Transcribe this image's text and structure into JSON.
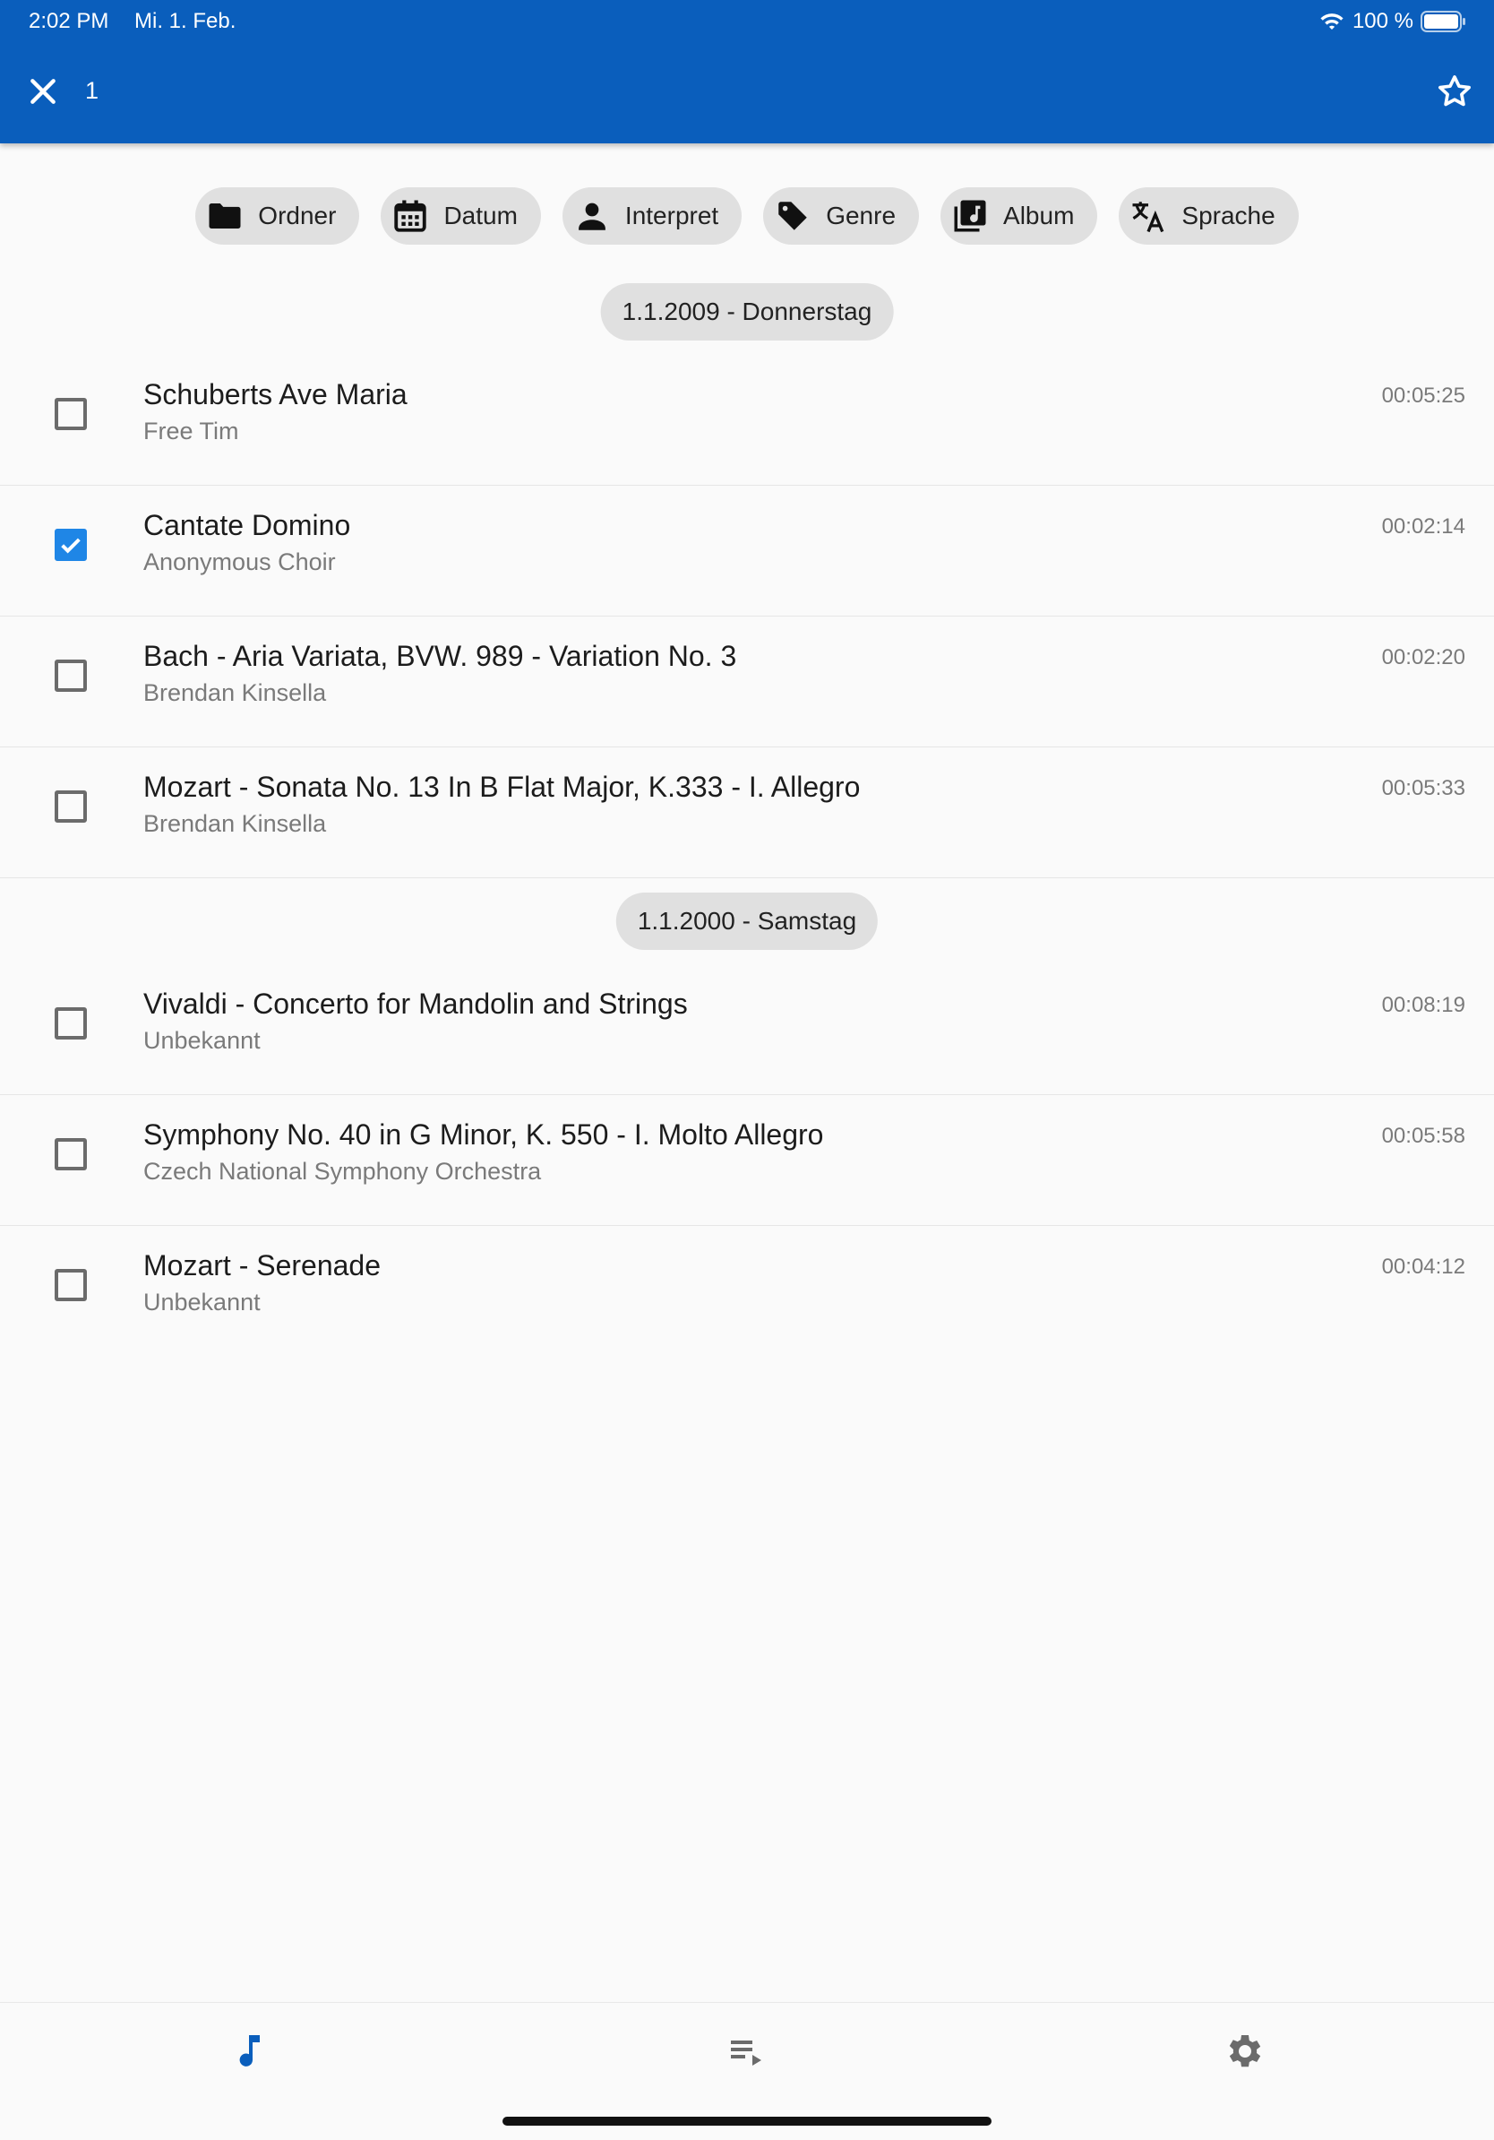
{
  "status_bar": {
    "time": "2:02 PM",
    "date": "Mi. 1. Feb.",
    "battery": "100 %"
  },
  "appbar": {
    "selected_count": "1"
  },
  "filters": [
    {
      "label": "Ordner",
      "icon": "folder-icon"
    },
    {
      "label": "Datum",
      "icon": "calendar-icon"
    },
    {
      "label": "Interpret",
      "icon": "person-icon"
    },
    {
      "label": "Genre",
      "icon": "tag-icon"
    },
    {
      "label": "Album",
      "icon": "album-icon"
    },
    {
      "label": "Sprache",
      "icon": "translate-icon"
    }
  ],
  "groups": [
    {
      "date": "1.1.2009 - Donnerstag",
      "tracks": [
        {
          "title": "Schuberts Ave Maria",
          "artist": "Free Tim",
          "duration": "00:05:25",
          "checked": false
        },
        {
          "title": "Cantate Domino",
          "artist": "Anonymous Choir",
          "duration": "00:02:14",
          "checked": true
        },
        {
          "title": "Bach - Aria Variata, BVW. 989 - Variation No. 3",
          "artist": "Brendan Kinsella",
          "duration": "00:02:20",
          "checked": false
        },
        {
          "title": "Mozart - Sonata No. 13 In B Flat Major, K.333 - I. Allegro",
          "artist": "Brendan Kinsella",
          "duration": "00:05:33",
          "checked": false
        }
      ]
    },
    {
      "date": "1.1.2000 - Samstag",
      "tracks": [
        {
          "title": "Vivaldi - Concerto for Mandolin and Strings",
          "artist": "Unbekannt",
          "duration": "00:08:19",
          "checked": false
        },
        {
          "title": "Symphony No. 40 in G Minor, K. 550 - I. Molto Allegro",
          "artist": "Czech National Symphony Orchestra",
          "duration": "00:05:58",
          "checked": false
        },
        {
          "title": "Mozart - Serenade",
          "artist": "Unbekannt",
          "duration": "00:04:12",
          "checked": false
        }
      ]
    }
  ],
  "bottom_nav": [
    {
      "icon": "music-note-icon",
      "active": true
    },
    {
      "icon": "queue-icon",
      "active": false
    },
    {
      "icon": "settings-icon",
      "active": false
    }
  ],
  "colors": {
    "appbar": "#0a5ebc",
    "accent": "#1f86e6",
    "nav_active": "#0a5ebc",
    "nav_inactive": "#6b6b6b"
  }
}
